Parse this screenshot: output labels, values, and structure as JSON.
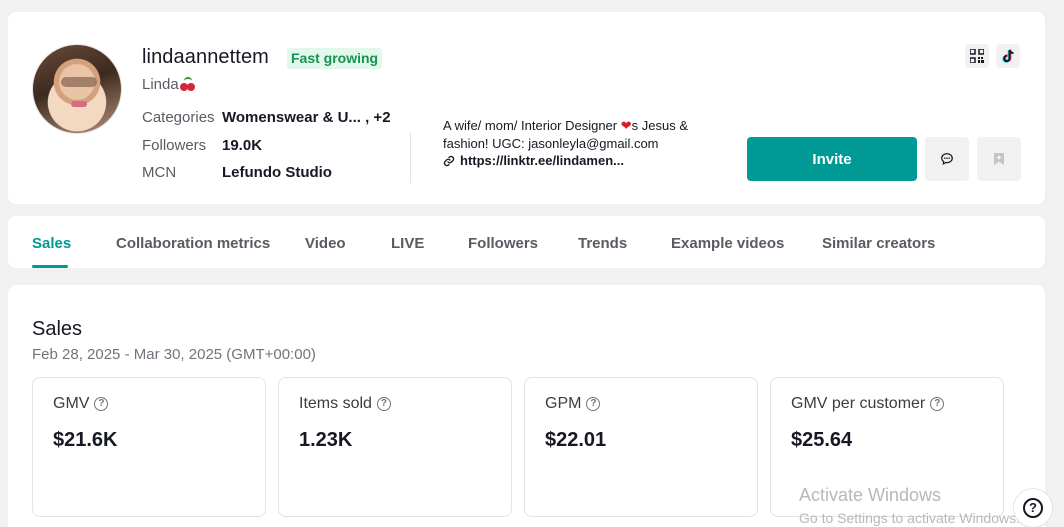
{
  "profile": {
    "username": "lindaannettem",
    "badge": "Fast growing",
    "nickname": "Linda",
    "categories_label": "Categories",
    "categories_value": "Womenswear & U... , +2",
    "followers_label": "Followers",
    "followers_value": "19.0K",
    "mcn_label": "MCN",
    "mcn_value": "Lefundo Studio",
    "bio_part1": "A wife/ mom/ Interior Designer ",
    "bio_heart": "❤",
    "bio_part2": "s Jesus & fashion! UGC: jasonleyla@gmail.com",
    "link": "https://linktr.ee/lindamen...",
    "invite_label": "Invite",
    "icons": [
      "qr-code-icon",
      "tiktok-icon",
      "message-icon",
      "bookmark-icon"
    ]
  },
  "tabs": [
    {
      "label": "Sales",
      "active": true
    },
    {
      "label": "Collaboration metrics"
    },
    {
      "label": "Video"
    },
    {
      "label": "LIVE"
    },
    {
      "label": "Followers"
    },
    {
      "label": "Trends"
    },
    {
      "label": "Example videos"
    },
    {
      "label": "Similar creators"
    }
  ],
  "sales": {
    "title": "Sales",
    "date_range": "Feb 28, 2025 - Mar 30, 2025 (GMT+00:00)",
    "metrics": [
      {
        "label": "GMV",
        "value": "$21.6K"
      },
      {
        "label": "Items sold",
        "value": "1.23K"
      },
      {
        "label": "GPM",
        "value": "$22.01"
      },
      {
        "label": "GMV per customer",
        "value": "$25.64"
      }
    ]
  },
  "watermark": {
    "title": "Activate Windows",
    "subtitle": "Go to Settings to activate Windows."
  },
  "colors": {
    "accent": "#009995",
    "badge_bg": "#e2f8ec",
    "badge_text": "#17934f",
    "page_bg": "#f1f1f2"
  }
}
